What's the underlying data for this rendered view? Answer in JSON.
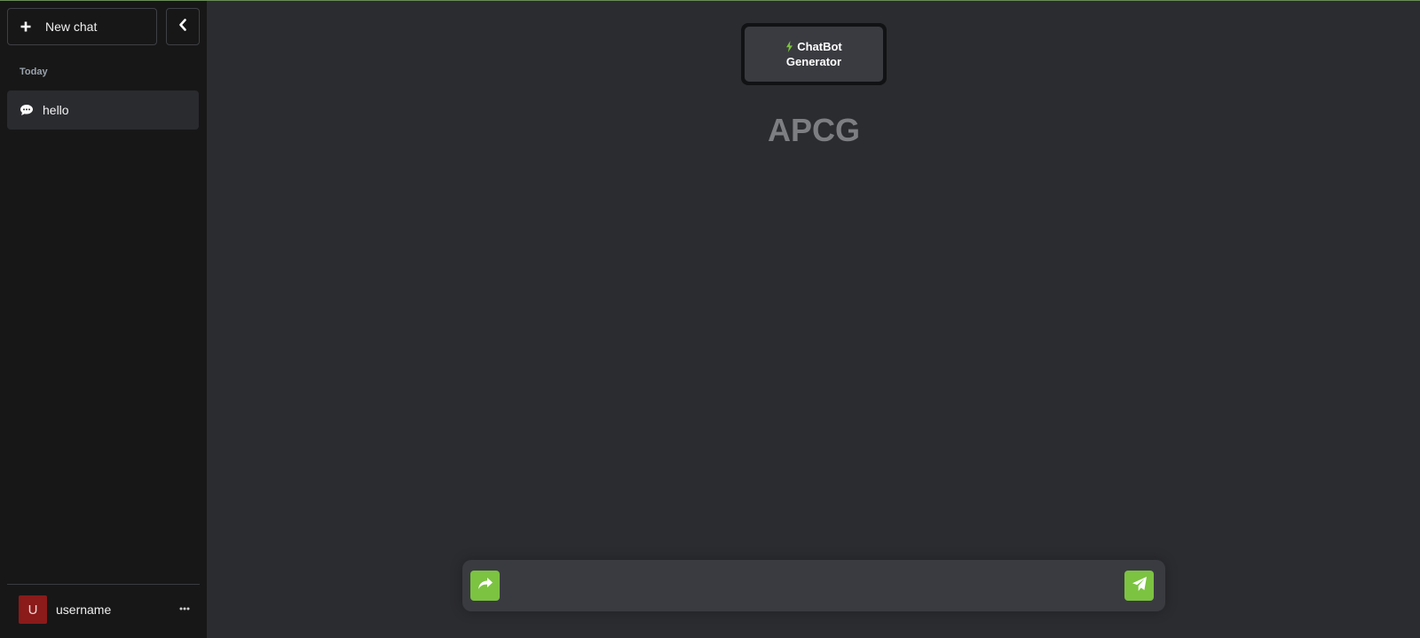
{
  "sidebar": {
    "new_chat_label": "New chat",
    "section_label": "Today",
    "chats": [
      {
        "title": "hello"
      }
    ],
    "user": {
      "avatar_initial": "U",
      "name": "username"
    }
  },
  "main": {
    "model_chip": {
      "line1": "ChatBot",
      "line2": "Generator"
    },
    "brand_title": "APCG",
    "composer": {
      "placeholder": ""
    }
  },
  "colors": {
    "accent_green": "#7cc341",
    "sidebar_bg": "#171717",
    "main_bg": "#2b2c30",
    "avatar_bg": "#8b1a1a"
  },
  "icons": {
    "new_chat": "plus-icon",
    "collapse": "chevron-left-icon",
    "chat_item": "speech-bubble-icon",
    "user_menu": "ellipsis-icon",
    "model_chip": "bolt-icon",
    "share": "share-arrow-icon",
    "send": "paper-plane-icon"
  }
}
